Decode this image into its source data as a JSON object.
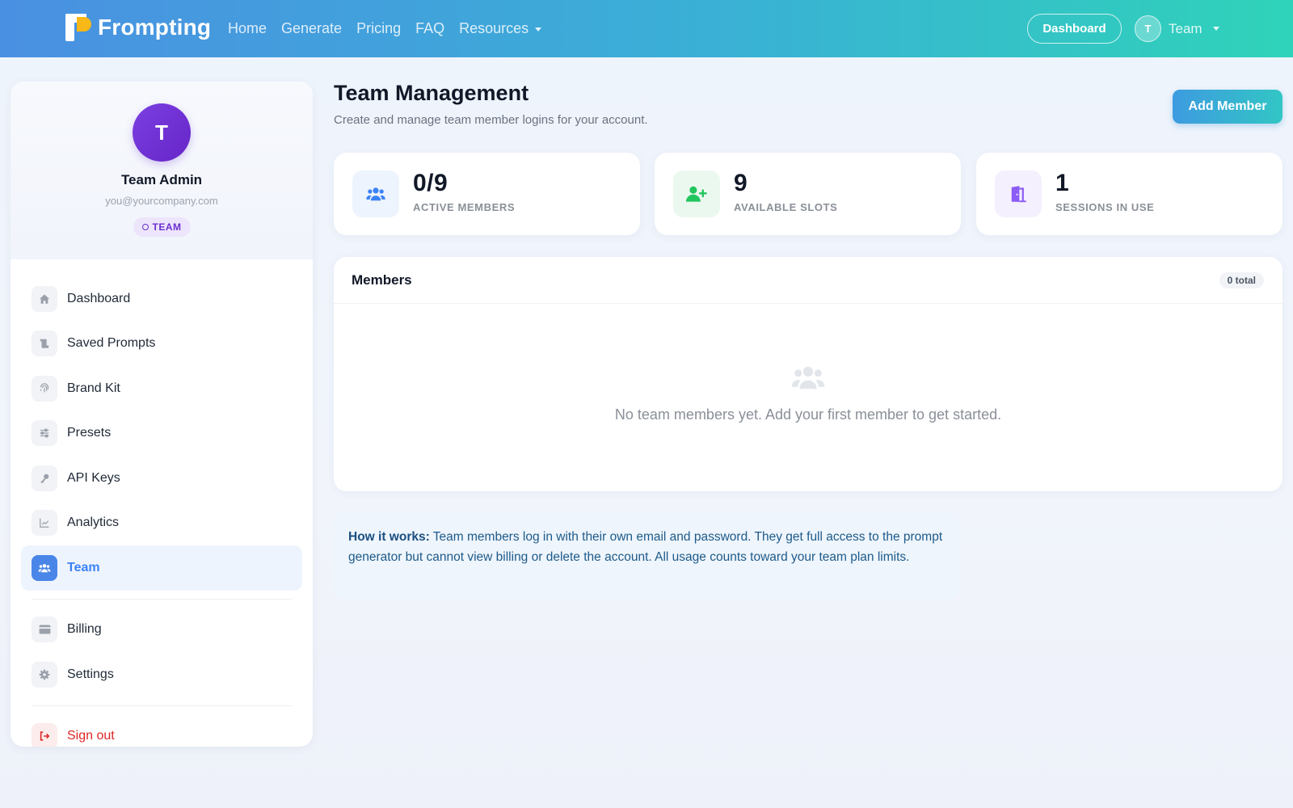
{
  "nav": {
    "brand": "Frompting",
    "links": [
      "Home",
      "Generate",
      "Pricing",
      "FAQ"
    ],
    "resources_label": "Resources",
    "dashboard_btn": "Dashboard",
    "user_initial": "T",
    "user_label": "Team"
  },
  "sidebar": {
    "profile": {
      "initial": "T",
      "name": "Team Admin",
      "email": "you@yourcompany.com",
      "plan": "TEAM"
    },
    "items": [
      {
        "label": "Dashboard",
        "icon": "home-icon"
      },
      {
        "label": "Saved Prompts",
        "icon": "scroll-icon"
      },
      {
        "label": "Brand Kit",
        "icon": "fingerprint-icon"
      },
      {
        "label": "Presets",
        "icon": "sliders-icon"
      },
      {
        "label": "API Keys",
        "icon": "key-icon"
      },
      {
        "label": "Analytics",
        "icon": "chart-line-icon"
      },
      {
        "label": "Team",
        "icon": "users-icon",
        "active": true
      },
      {
        "label": "Billing",
        "icon": "credit-card-icon"
      },
      {
        "label": "Settings",
        "icon": "gear-icon"
      },
      {
        "label": "Sign out",
        "icon": "sign-out-icon"
      }
    ]
  },
  "page": {
    "title": "Team Management",
    "subtitle": "Create and manage team member logins for your account.",
    "add_button": "Add Member"
  },
  "stats": [
    {
      "value": "0/9",
      "label": "ACTIVE MEMBERS",
      "icon": "users-icon",
      "color": "#3b82f6"
    },
    {
      "value": "9",
      "label": "AVAILABLE SLOTS",
      "icon": "user-plus-icon",
      "color": "#22c55e"
    },
    {
      "value": "1",
      "label": "SESSIONS IN USE",
      "icon": "door-open-icon",
      "color": "#8b5cf6"
    }
  ],
  "members": {
    "title": "Members",
    "total": "0 total",
    "empty_text": "No team members yet. Add your first member to get started."
  },
  "info": {
    "lead": "How it works:",
    "text": " Team members log in with their own email and password. They get full access to the prompt generator but cannot view billing or delete the account. All usage counts toward your team plan limits."
  },
  "colors": {
    "accent": "#3b82f6",
    "plan_badge": "#6b2fd1",
    "danger": "#dc2626"
  }
}
